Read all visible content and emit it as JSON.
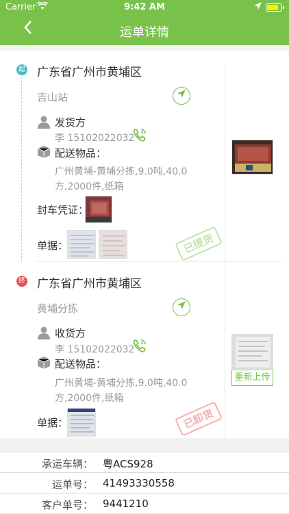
{
  "status_bar": {
    "carrier": "Carrier",
    "time": "9:42 AM"
  },
  "nav": {
    "back_icon": "chevron-left-icon",
    "title": "运单详情"
  },
  "origin": {
    "marker": "起",
    "marker_color": "#4cb7c6",
    "address": "广东省广州市黄埔区",
    "station": "吉山站",
    "party_label": "发货方",
    "contact": "李  15102022032",
    "goods_label": "配送物品：",
    "goods_line1": "广州黄埔-黄埔分拣,9.0吨,40.0",
    "goods_line2": "方,2000件,纸箱",
    "seal_label": "封车凭证：",
    "receipt_label": "单据：",
    "stamp": "已提货",
    "stamp_color": "#79c24a"
  },
  "destination": {
    "marker": "终",
    "marker_color": "#e94d4d",
    "address": "广东省广州市黄埔区",
    "station": "黄埔分拣",
    "party_label": "收货方",
    "contact": "李  15102022032",
    "goods_label": "配送物品：",
    "goods_line1": "广州黄埔-黄埔分拣,9.0吨,40.0",
    "goods_line2": "方,2000件,纸箱",
    "receipt_label": "单据：",
    "reupload": "重新上传",
    "stamp": "已卸货",
    "stamp_color": "#e94d4d"
  },
  "info": {
    "vehicle_label": "承运车辆：",
    "vehicle": "粤ACS928",
    "waybill_label": "运单号：",
    "waybill": "41493330558",
    "customer_label": "客户单号：",
    "customer": "9441210"
  },
  "accent_color": "#79c24a"
}
